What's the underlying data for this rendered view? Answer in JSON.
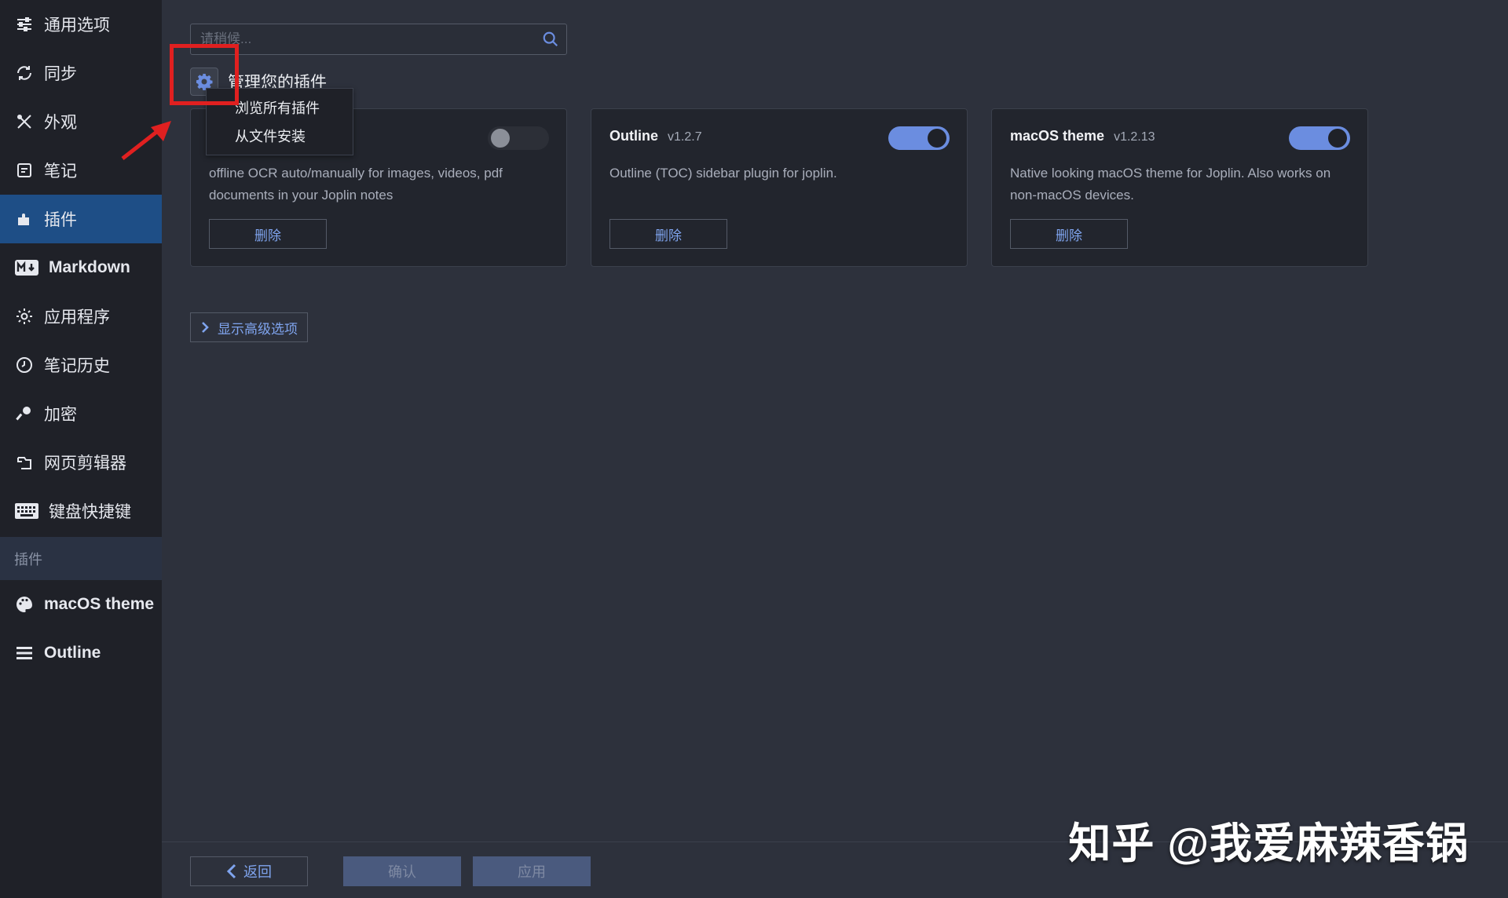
{
  "sidebar": {
    "items": [
      {
        "label": "通用选项",
        "icon": "sliders-icon"
      },
      {
        "label": "同步",
        "icon": "sync-icon"
      },
      {
        "label": "外观",
        "icon": "paint-icon"
      },
      {
        "label": "笔记",
        "icon": "note-icon"
      },
      {
        "label": "插件",
        "icon": "puzzle-icon",
        "active": true
      },
      {
        "label": "Markdown",
        "icon": "markdown-icon"
      },
      {
        "label": "应用程序",
        "icon": "gear-icon"
      },
      {
        "label": "笔记历史",
        "icon": "history-icon"
      },
      {
        "label": "加密",
        "icon": "key-icon"
      },
      {
        "label": "网页剪辑器",
        "icon": "clipper-icon"
      },
      {
        "label": "键盘快捷键",
        "icon": "keyboard-icon"
      }
    ],
    "section_label": "插件",
    "plugin_items": [
      {
        "label": "macOS theme",
        "icon": "palette-icon"
      },
      {
        "label": "Outline",
        "icon": "menu-icon"
      }
    ]
  },
  "search": {
    "placeholder": "请稍候..."
  },
  "manage": {
    "title": "管理您的插件"
  },
  "dropdown": {
    "items": [
      "浏览所有插件",
      "从文件安装"
    ]
  },
  "plugins": [
    {
      "name": "",
      "version": "",
      "description": "offline OCR auto/manually for images, videos, pdf documents in your Joplin notes",
      "enabled": false,
      "delete_label": "删除"
    },
    {
      "name": "Outline",
      "version": "v1.2.7",
      "description": "Outline (TOC) sidebar plugin for joplin.",
      "enabled": true,
      "delete_label": "删除"
    },
    {
      "name": "macOS theme",
      "version": "v1.2.13",
      "description": "Native looking macOS theme for Joplin. Also works on non-macOS devices.",
      "enabled": true,
      "delete_label": "删除"
    }
  ],
  "advanced": {
    "label": "显示高级选项"
  },
  "footer": {
    "back_label": "返回",
    "confirm_label": "确认",
    "apply_label": "应用"
  },
  "watermark": {
    "text": "知乎 @我爱麻辣香锅"
  },
  "colors": {
    "accent": "#6b8de0",
    "sidebar_bg": "#1f2128",
    "main_bg": "#2d313c",
    "active_bg": "#1e4e86",
    "highlight": "#e02020"
  }
}
